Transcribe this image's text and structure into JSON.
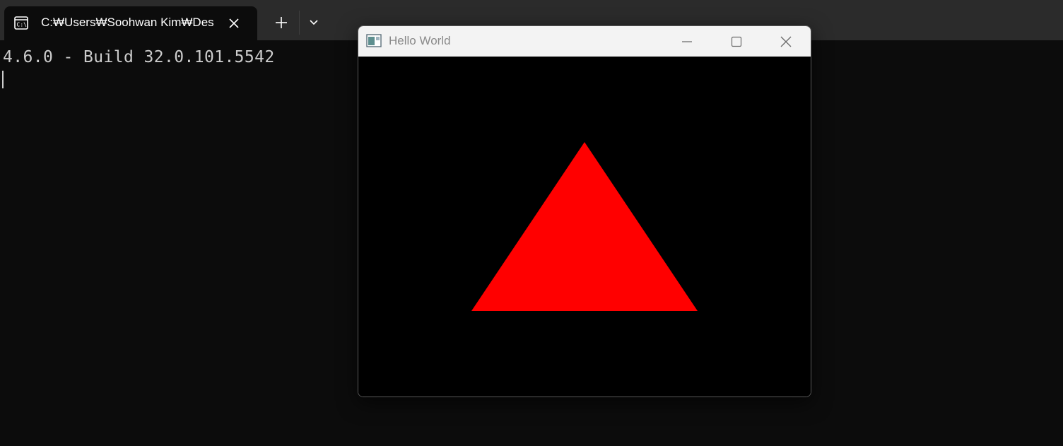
{
  "terminal": {
    "tab": {
      "title": "C:₩Users₩Soohwan Kim₩Des",
      "icon": "command-prompt-icon"
    },
    "buttons": {
      "close_tab_icon": "close-icon",
      "new_tab_icon": "plus-icon",
      "dropdown_icon": "chevron-down-icon"
    },
    "output_lines": [
      "4.6.0 - Build 32.0.101.5542"
    ]
  },
  "gl_window": {
    "title": "Hello World",
    "icon": "application-window-icon",
    "controls": [
      "minimize-icon",
      "maximize-icon",
      "close-icon"
    ],
    "scene": {
      "background_color": "#000000",
      "shape": "triangle",
      "fill_color": "#ff0000"
    }
  },
  "colors": {
    "tabbar": "#2b2b2b",
    "terminal_bg": "#0c0c0c",
    "terminal_text": "#cccccc",
    "titlebar": "#f3f3f3"
  }
}
